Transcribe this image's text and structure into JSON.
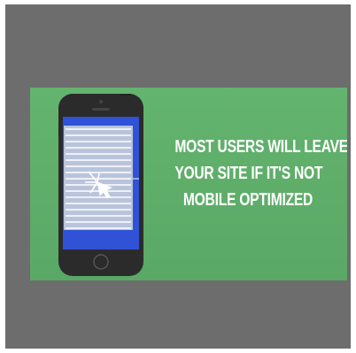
{
  "background": {
    "outer_color": "#ffffff",
    "frame_color": "#6d6d6d",
    "slide_color": "#5fb06a"
  },
  "phone": {
    "icon": "smartphone-icon",
    "body_color": "#2b2b2b",
    "screen_frame_color": "#2f52d6",
    "page_color": "#b9c4dc",
    "page_line_color": "#ffffff",
    "tap_icon": "tap-cursor-icon"
  },
  "headline": {
    "lines": [
      "MOST USERS WILL LEAVE",
      "YOUR SITE IF IT'S NOT",
      "MOBILE OPTIMIZED"
    ],
    "color": "#ffffff"
  }
}
